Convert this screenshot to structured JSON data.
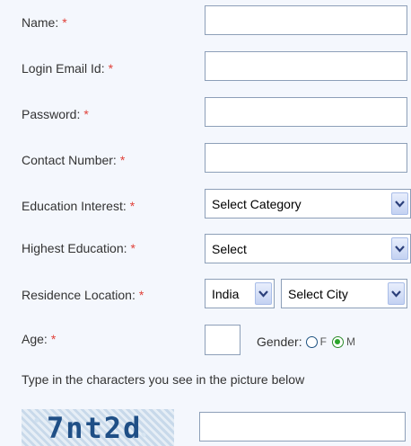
{
  "required_mark": "*",
  "fields": {
    "name": {
      "label": "Name:",
      "value": ""
    },
    "email": {
      "label": "Login Email Id:",
      "value": ""
    },
    "password": {
      "label": "Password:",
      "value": ""
    },
    "contact": {
      "label": "Contact Number:",
      "value": ""
    },
    "education_interest": {
      "label": "Education Interest:",
      "selected": "Select Category"
    },
    "highest_education": {
      "label": "Highest Education:",
      "selected": "Select"
    },
    "residence": {
      "label": "Residence Location:",
      "country_selected": "India",
      "city_selected": "Select City"
    },
    "age": {
      "label": "Age:",
      "value": ""
    },
    "gender": {
      "label": "Gender:",
      "options": [
        "F",
        "M"
      ],
      "selected": "M"
    }
  },
  "captcha": {
    "instruction": "Type in the characters you see in the picture below",
    "image_text": "7nt2d",
    "value": ""
  },
  "colors": {
    "accent": "#1f4f86",
    "required": "#e0413a",
    "field_border": "#8d9fb8"
  },
  "icons": {
    "dropdown": "chevron-down-icon"
  }
}
